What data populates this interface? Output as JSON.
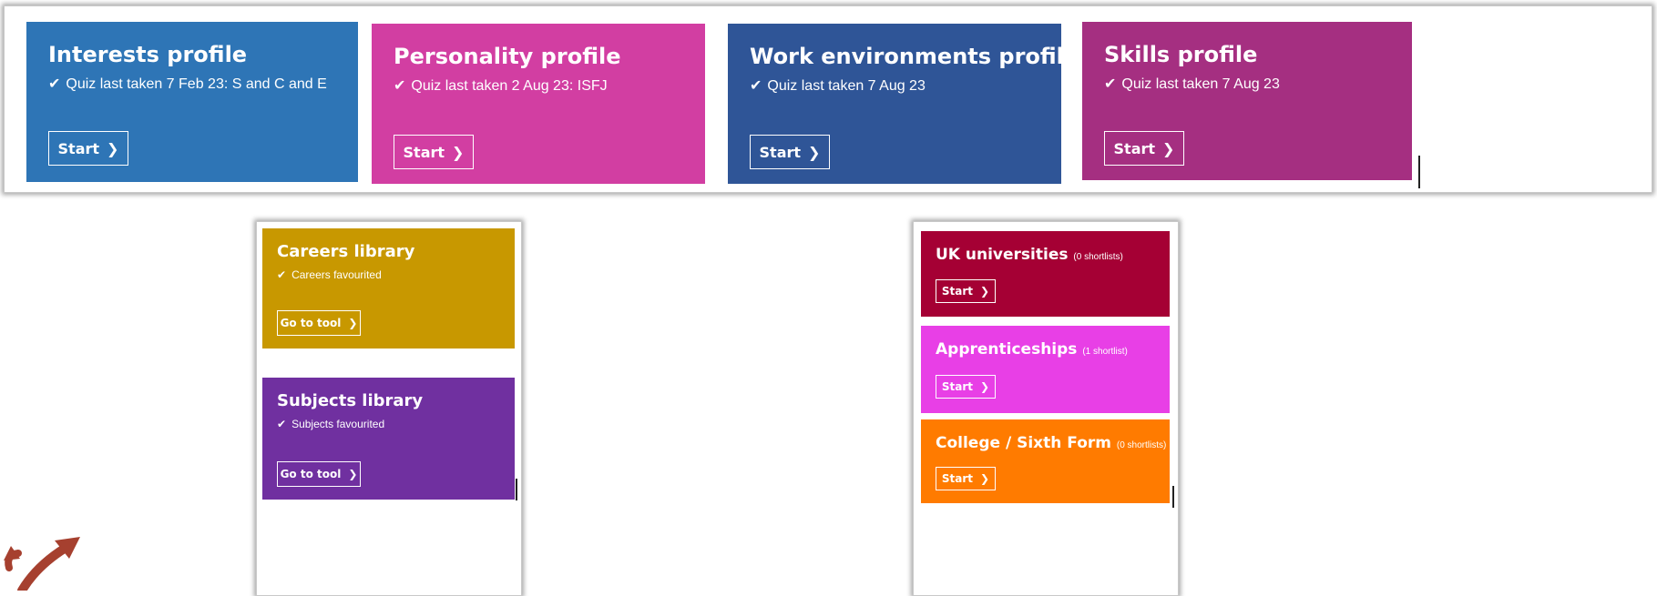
{
  "profiles": [
    {
      "title": "Interests profile",
      "status": "Quiz last taken 7 Feb 23: S and C and E",
      "button": "Start",
      "color": "#2e75b6"
    },
    {
      "title": "Personality profile",
      "status": "Quiz last taken 2 Aug 23: ISFJ",
      "button": "Start",
      "color": "#d23ea2"
    },
    {
      "title": "Work environments profile",
      "status": "Quiz last taken 7 Aug 23",
      "button": "Start",
      "color": "#2f5597"
    },
    {
      "title": "Skills profile",
      "status": "Quiz last taken 7 Aug 23",
      "button": "Start",
      "color": "#a52f81"
    }
  ],
  "libraries": [
    {
      "title": "Careers library",
      "status": "Careers favourited",
      "button": "Go to tool",
      "color": "#c89800"
    },
    {
      "title": "Subjects library",
      "status": "Subjects favourited",
      "button": "Go to tool",
      "color": "#7030a0"
    }
  ],
  "destinations": [
    {
      "title": "UK universities",
      "count": "(0 shortlists)",
      "button": "Start",
      "color": "#a50034"
    },
    {
      "title": "Apprenticeships",
      "count": "(1 shortlist)",
      "button": "Start",
      "color": "#e83fe6"
    },
    {
      "title": "College / Sixth Form",
      "count": "(0 shortlists)",
      "button": "Start",
      "color": "#ff7b00"
    }
  ],
  "icons": {
    "tick": "check-icon",
    "chevron": "chevron-right-icon",
    "arrows": "curved-arrows-icon"
  }
}
